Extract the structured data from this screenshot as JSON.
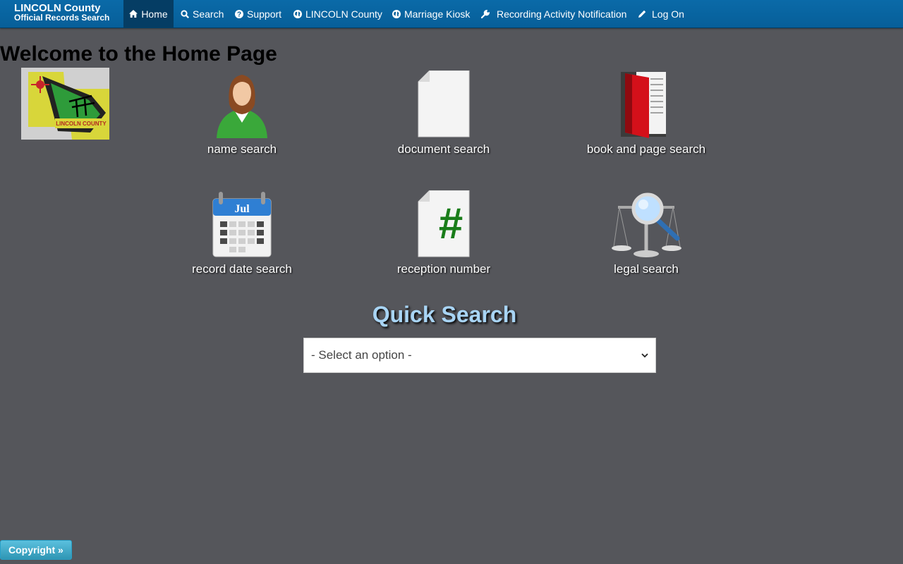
{
  "navbar": {
    "brand_line1": "LINCOLN County",
    "brand_line2": "Official Records Search",
    "items": [
      {
        "label": "Home",
        "icon": "home-icon"
      },
      {
        "label": "Search",
        "icon": "search-icon"
      },
      {
        "label": "Support",
        "icon": "question-circle-icon"
      },
      {
        "label": "LINCOLN County",
        "icon": "globe-icon"
      },
      {
        "label": "Marriage Kiosk",
        "icon": "globe-icon"
      },
      {
        "label": "Recording Activity Notification",
        "icon": "wrench-icon"
      },
      {
        "label": "Log On",
        "icon": "pencil-icon"
      }
    ]
  },
  "page": {
    "title": "Welcome to the Home Page",
    "logo_text": "LINCOLN COUNTY"
  },
  "tiles": [
    {
      "label": "name search",
      "icon": "person-icon"
    },
    {
      "label": "document search",
      "icon": "document-icon"
    },
    {
      "label": "book and page search",
      "icon": "red-book-icon"
    },
    {
      "label": "record date search",
      "icon": "calendar-icon",
      "icon_text": "Jul"
    },
    {
      "label": "reception number",
      "icon": "hash-document-icon",
      "icon_text": "#"
    },
    {
      "label": "legal search",
      "icon": "scales-magnifier-icon"
    }
  ],
  "quick_search": {
    "title": "Quick Search",
    "selected": "- Select an option -"
  },
  "footer": {
    "copyright": "Copyright »"
  },
  "colors": {
    "navbar": "#075f99",
    "active_nav": "#053d64",
    "background": "#55565b",
    "quick_title": "#a8d4f4",
    "copyright_button": "#2f96b4"
  }
}
